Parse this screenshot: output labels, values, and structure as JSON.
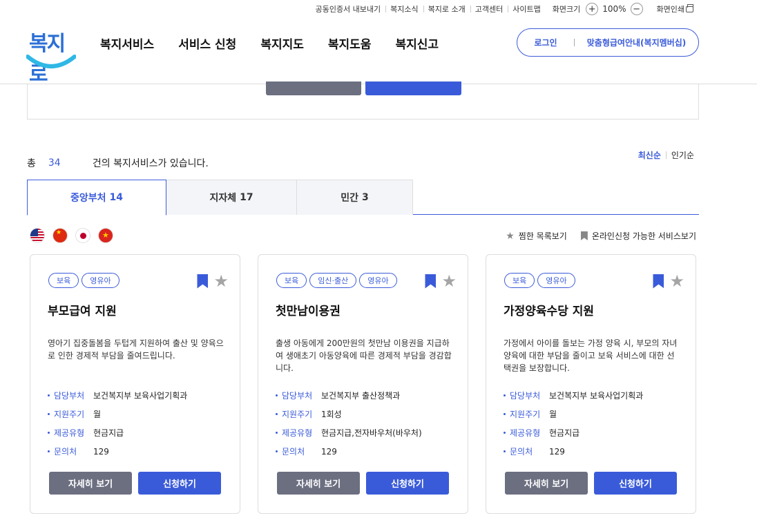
{
  "utility": {
    "links": [
      "공동인증서 내보내기",
      "복지소식",
      "복지로 소개",
      "고객센터",
      "사이트맵"
    ],
    "zoom_label": "화면크기",
    "zoom_in": "+",
    "zoom_value": "100%",
    "zoom_out": "−",
    "print": "화면인쇄"
  },
  "logo": {
    "text": "복지로"
  },
  "gnb": [
    "복지서비스",
    "서비스 신청",
    "복지지도",
    "복지도움",
    "복지신고"
  ],
  "member": {
    "login": "로그인",
    "custom": "맞춤형급여안내(복지멤버십)"
  },
  "count": {
    "prefix": "총",
    "value": "34",
    "suffix": "건의 복지서비스가 있습니다."
  },
  "sort": {
    "latest": "최신순",
    "popular": "인기순"
  },
  "tabs": [
    {
      "label": "중앙부처",
      "count": "14"
    },
    {
      "label": "지자체",
      "count": "17"
    },
    {
      "label": "민간",
      "count": "3"
    }
  ],
  "view_options": {
    "favorites": "찜한 목록보기",
    "online": "온라인신청 가능한 서비스보기"
  },
  "info_labels": {
    "dept": "담당부처",
    "cycle": "지원주기",
    "type": "제공유형",
    "contact": "문의처"
  },
  "buttons": {
    "detail": "자세히 보기",
    "apply": "신청하기"
  },
  "cards": [
    {
      "tags": [
        "보육",
        "영유아"
      ],
      "title": "부모급여 지원",
      "desc": "영아기 집중돌봄을 두텁게 지원하여 출산 및 양육으로 인한 경제적 부담을 줄여드립니다.",
      "dept": "보건복지부 보육사업기획과",
      "cycle": "월",
      "type": "현금지급",
      "contact": "129"
    },
    {
      "tags": [
        "보육",
        "임신·출산",
        "영유아"
      ],
      "title": "첫만남이용권",
      "desc": "출생 아동에게 200만원의 첫만남 이용권을 지급하여 생애초기 아동양육에 따른 경제적 부담을 경감합니다.",
      "dept": "보건복지부 출산정책과",
      "cycle": "1회성",
      "type": "현금지급,전자바우처(바우처)",
      "contact": "129"
    },
    {
      "tags": [
        "보육",
        "영유아"
      ],
      "title": "가정양육수당 지원",
      "desc": "가정에서 아이를 돌보는 가정 양육 시, 부모의 자녀양육에 대한 부담을 줄이고 보육 서비스에 대한 선택권을 보장합니다.",
      "dept": "보건복지부 보육사업기획과",
      "cycle": "월",
      "type": "현금지급",
      "contact": "129"
    }
  ]
}
